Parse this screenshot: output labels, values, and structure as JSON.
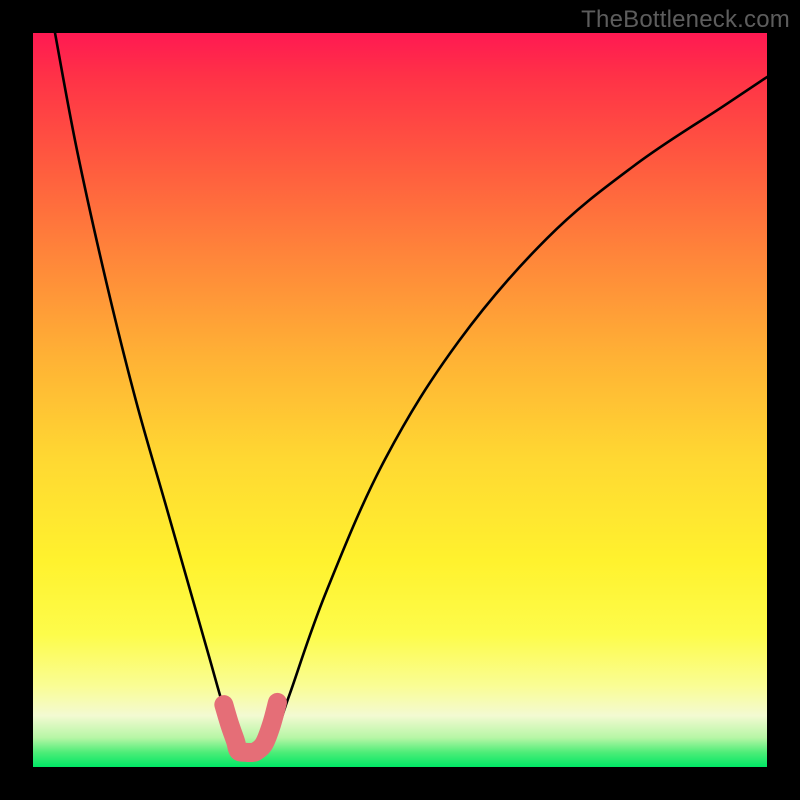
{
  "watermark": "TheBottleneck.com",
  "chart_data": {
    "type": "line",
    "title": "",
    "xlabel": "",
    "ylabel": "",
    "xlim": [
      0,
      100
    ],
    "ylim": [
      0,
      100
    ],
    "grid": false,
    "series": [
      {
        "name": "main-curve",
        "color": "#000000",
        "x": [
          3,
          6,
          10,
          14,
          18,
          22,
          24,
          26,
          27.4,
          28,
          29,
          30,
          31,
          33,
          35,
          40,
          48,
          58,
          70,
          82,
          94,
          100
        ],
        "y": [
          100,
          84,
          66,
          50,
          36,
          22,
          15,
          8,
          4,
          2.2,
          2,
          2,
          2.2,
          4.5,
          10,
          24,
          42,
          58,
          72,
          82,
          90,
          94
        ]
      },
      {
        "name": "valley-band",
        "color": "#e56e77",
        "x": [
          26,
          26.8,
          27.6,
          28,
          29,
          30,
          30.5,
          31.5,
          32.5,
          33.3
        ],
        "y": [
          8.5,
          5.8,
          3.5,
          2.2,
          2,
          2,
          2.2,
          3.2,
          5.8,
          8.8
        ]
      }
    ],
    "annotations": []
  }
}
